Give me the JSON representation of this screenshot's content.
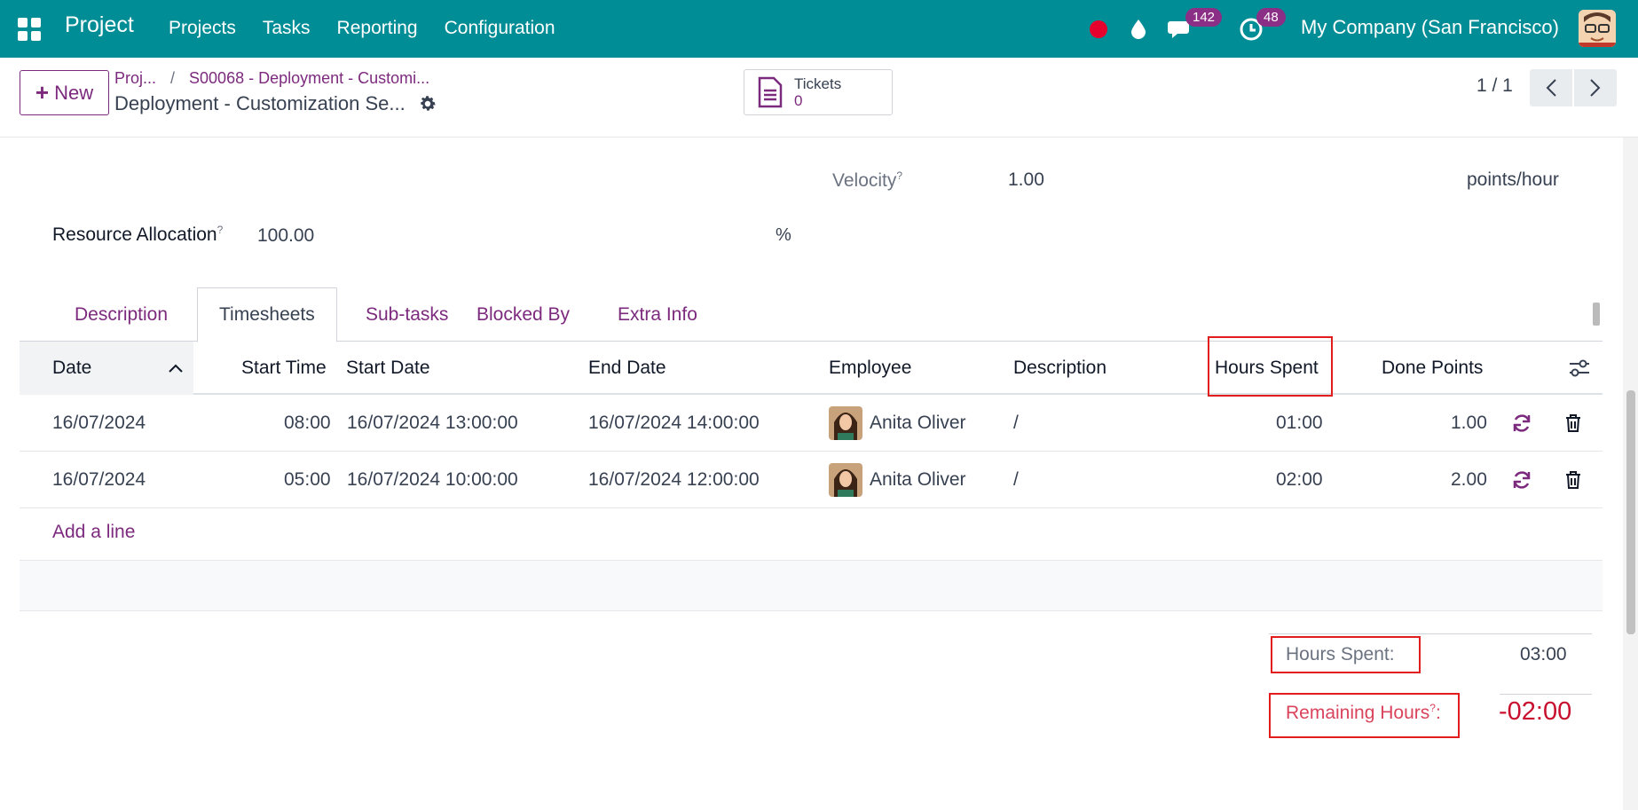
{
  "topbar": {
    "app_name": "Project",
    "nav": [
      "Projects",
      "Tasks",
      "Reporting",
      "Configuration"
    ],
    "chat_badge": "142",
    "activity_badge": "48",
    "company": "My Company (San Francisco)",
    "color": "#018d96"
  },
  "controls": {
    "new_label": "New",
    "breadcrumb_root": "Proj...",
    "breadcrumb_sep": "/",
    "breadcrumb_parent": "S00068 - Deployment - Customi...",
    "record_title": "Deployment - Customization Se...",
    "tickets_label": "Tickets",
    "tickets_count": "0",
    "pager": "1 / 1"
  },
  "form": {
    "velocity_label": "Velocity",
    "velocity_help": "?",
    "velocity_value": "1.00",
    "velocity_unit": "points/hour",
    "resource_label": "Resource Allocation",
    "resource_help": "?",
    "resource_value": "100.00",
    "resource_unit": "%"
  },
  "tabs": [
    "Description",
    "Timesheets",
    "Sub-tasks",
    "Blocked By",
    "Extra Info"
  ],
  "table": {
    "headers": {
      "date": "Date",
      "start_time": "Start Time",
      "start_date": "Start Date",
      "end_date": "End Date",
      "employee": "Employee",
      "description": "Description",
      "hours_spent": "Hours Spent",
      "done_points": "Done Points"
    },
    "rows": [
      {
        "date": "16/07/2024",
        "start_time": "08:00",
        "start_date": "16/07/2024 13:00:00",
        "end_date": "16/07/2024 14:00:00",
        "employee": "Anita Oliver",
        "description": "/",
        "hours_spent": "01:00",
        "done_points": "1.00"
      },
      {
        "date": "16/07/2024",
        "start_time": "05:00",
        "start_date": "16/07/2024 10:00:00",
        "end_date": "16/07/2024 12:00:00",
        "employee": "Anita Oliver",
        "description": "/",
        "hours_spent": "02:00",
        "done_points": "2.00"
      }
    ],
    "add_line": "Add a line"
  },
  "summary": {
    "hours_spent_label": "Hours Spent:",
    "hours_spent_value": "03:00",
    "remaining_label": "Remaining Hours",
    "remaining_help": "?",
    "remaining_colon": ":",
    "remaining_value": "-02:00"
  }
}
